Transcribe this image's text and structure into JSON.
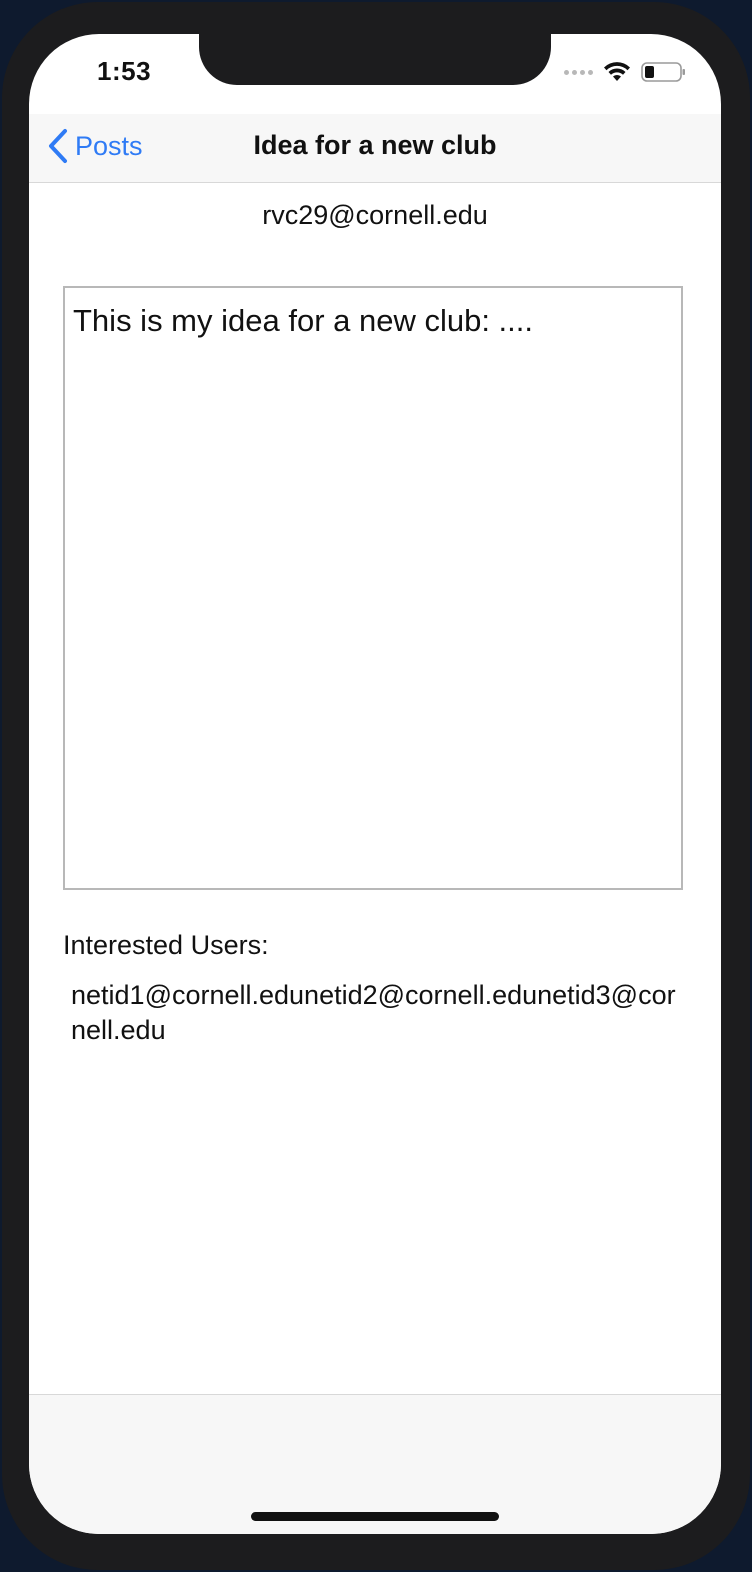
{
  "status_bar": {
    "time": "1:53",
    "icons": [
      "cellular-signal-icon",
      "wifi-icon",
      "battery-icon"
    ]
  },
  "nav": {
    "back_label": "Posts",
    "back_icon": "chevron-left-icon",
    "title": "Idea for a new club"
  },
  "post": {
    "author": "rvc29@cornell.edu",
    "body": "This is my idea for a new club: ...."
  },
  "interested": {
    "label": "Interested Users:",
    "users": "netid1@cornell.edunetid2@cornell.edunetid3@cornell.edu"
  },
  "colors": {
    "accent": "#2f7bf5",
    "nav_background": "#f7f7f7",
    "text": "#111111",
    "border": "#b8b8b8"
  }
}
